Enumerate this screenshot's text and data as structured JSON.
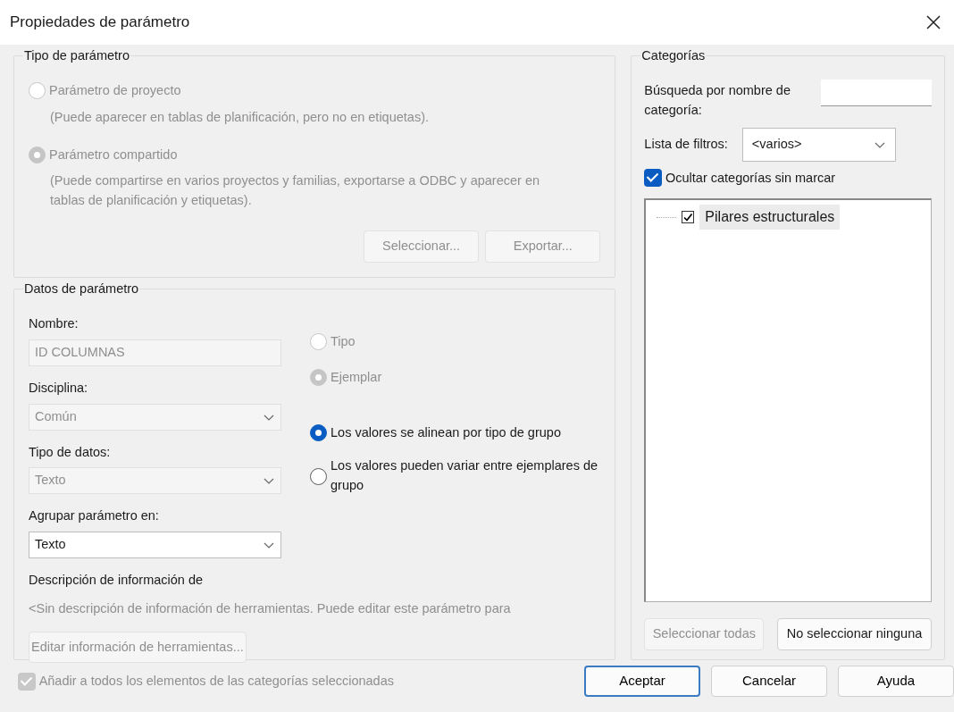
{
  "window": {
    "title": "Propiedades de parámetro"
  },
  "parameter_type": {
    "legend": "Tipo de parámetro",
    "options": [
      {
        "label": "Parámetro de proyecto",
        "note": "(Puede aparecer en tablas de planificación, pero no en etiquetas).",
        "selected": false,
        "disabled": true
      },
      {
        "label": "Parámetro compartido",
        "note": "(Puede compartirse en varios proyectos y familias, exportarse a ODBC y aparecer en tablas de planificación y etiquetas).",
        "selected": true,
        "disabled": true
      }
    ],
    "buttons": [
      {
        "label": "Seleccionar...",
        "disabled": true
      },
      {
        "label": "Exportar...",
        "disabled": true
      }
    ]
  },
  "parameter_data": {
    "legend": "Datos de parámetro",
    "fields": [
      {
        "kind": "text",
        "label": "Nombre:",
        "value": "ID COLUMNAS",
        "disabled": true
      },
      {
        "kind": "select",
        "label": "Disciplina:",
        "value": "Común",
        "disabled": true
      },
      {
        "kind": "select",
        "label": "Tipo de datos:",
        "value": "Texto",
        "disabled": true
      },
      {
        "kind": "select",
        "label": "Agrupar parámetro en:",
        "value": "Texto",
        "disabled": false
      }
    ],
    "type_options": [
      {
        "label": "Tipo",
        "selected": false,
        "disabled": true
      },
      {
        "label": "Ejemplar",
        "selected": true,
        "disabled": true
      }
    ],
    "group_options": [
      {
        "label": "Los valores se alinean por tipo de grupo",
        "selected": true,
        "disabled": false
      },
      {
        "label": "Los valores pueden variar entre ejemplares de grupo",
        "selected": false,
        "disabled": false
      }
    ],
    "description_label": "Descripción de información de",
    "description": "<Sin descripción de información de herramientas. Puede editar este parámetro para",
    "edit_button": {
      "label": "Editar información de herramientas...",
      "disabled": true
    }
  },
  "categories": {
    "legend": "Categorías",
    "search_label": "Búsqueda por nombre de categoría:",
    "filter_label": "Lista de filtros:",
    "filter_value": "<varios>",
    "hide_unchecked": {
      "label": "Ocultar categorías sin marcar",
      "checked": true
    },
    "tree": [
      {
        "label": "Pilares estructurales",
        "checked": true
      }
    ],
    "buttons": [
      {
        "label": "Seleccionar todas",
        "disabled": true
      },
      {
        "label": "No seleccionar ninguna",
        "disabled": false
      }
    ]
  },
  "add_to_all": {
    "label": "Añadir a todos los elementos de las categorías seleccionadas",
    "checked": true,
    "disabled": true
  },
  "buttons": [
    {
      "label": "Aceptar",
      "default": true
    },
    {
      "label": "Cancelar",
      "default": false
    },
    {
      "label": "Ayuda",
      "default": false
    }
  ]
}
